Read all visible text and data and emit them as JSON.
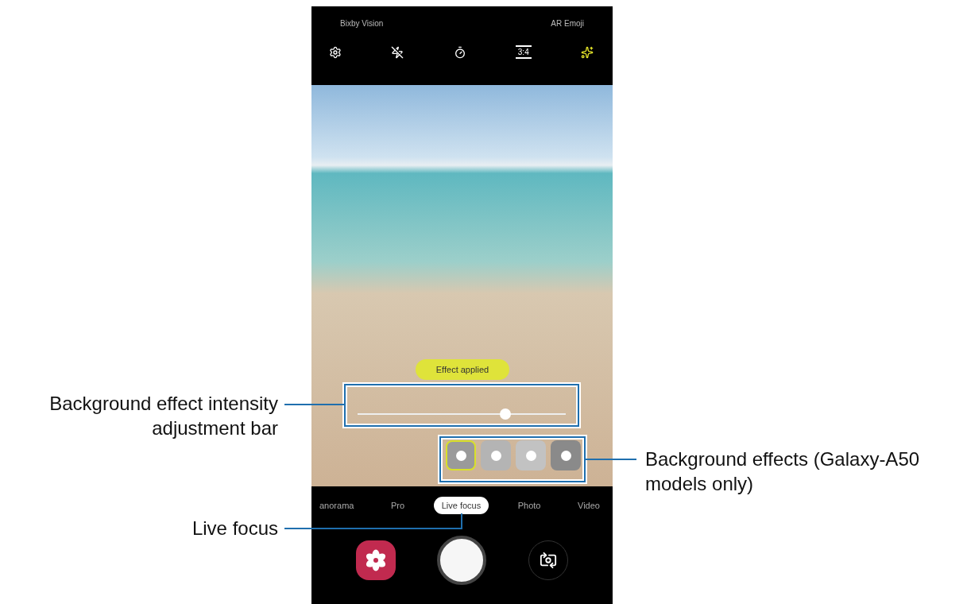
{
  "top_bar": {
    "links": [
      "Bixby Vision",
      "AR Emoji"
    ],
    "ratio": "3:4",
    "icons": [
      {
        "kind": "settings",
        "active": false
      },
      {
        "kind": "flash-off",
        "active": false
      },
      {
        "kind": "timer",
        "active": false
      },
      {
        "kind": "ratio",
        "active": false
      },
      {
        "kind": "effects",
        "active": true
      }
    ]
  },
  "viewfinder": {
    "effect_badge": "Effect applied",
    "intensity": {
      "level": 0.71
    },
    "effects": [
      {
        "selected": true,
        "color": "#9a9a9a"
      },
      {
        "selected": false,
        "color": "#b4b4b4"
      },
      {
        "selected": false,
        "color": "#c2c2c2"
      },
      {
        "selected": false,
        "color": "#8a8a8a"
      }
    ]
  },
  "modes": [
    {
      "label": "anorama",
      "selected": false
    },
    {
      "label": "Pro",
      "selected": false
    },
    {
      "label": "Live focus",
      "selected": true
    },
    {
      "label": "Photo",
      "selected": false
    },
    {
      "label": "Video",
      "selected": false
    }
  ],
  "callouts": [
    {
      "text": "Background effect intensity adjustment bar"
    },
    {
      "text": "Background effects (Galaxy-A50 models only)"
    },
    {
      "text": "Live focus"
    }
  ]
}
